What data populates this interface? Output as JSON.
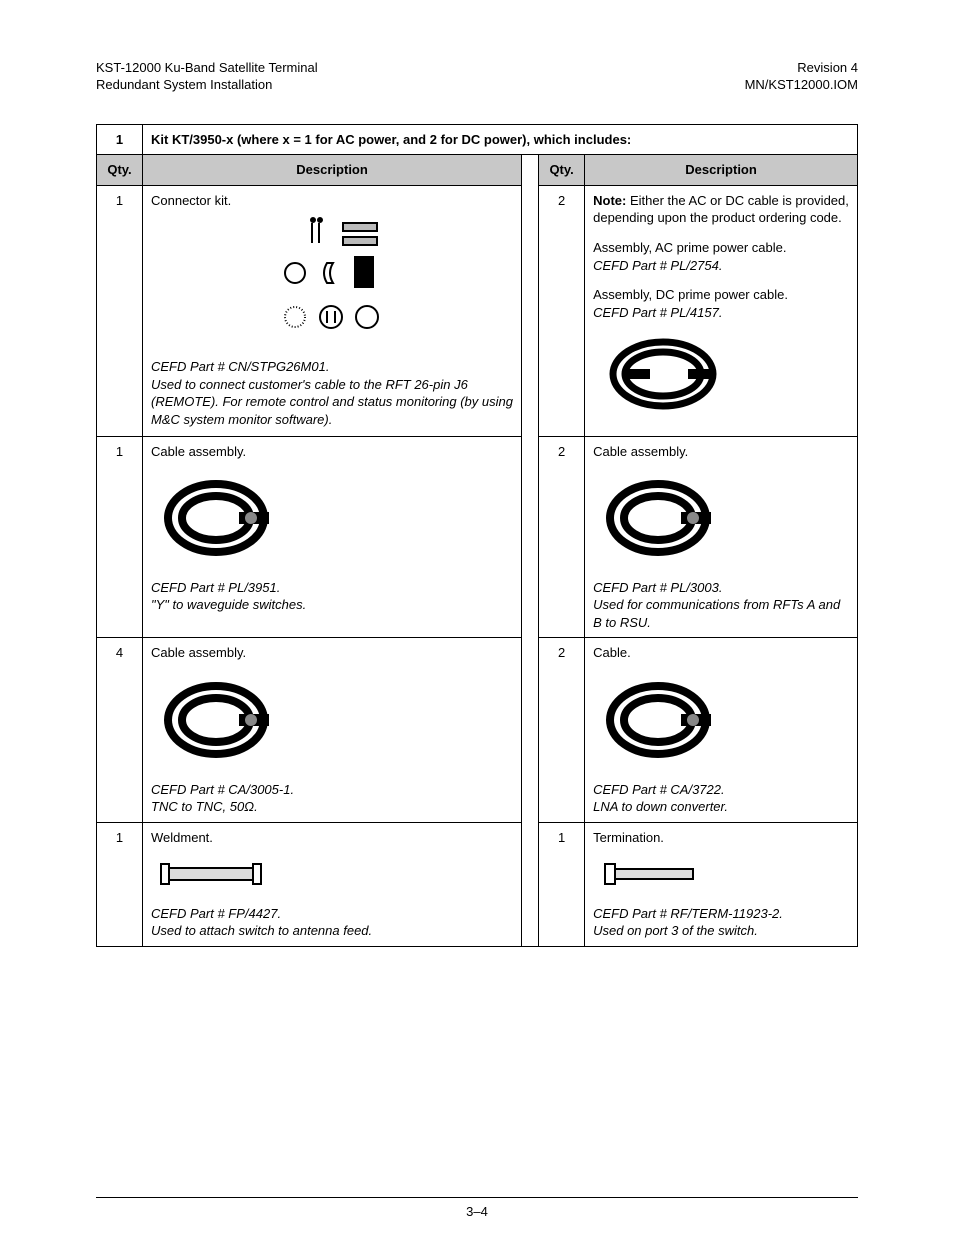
{
  "header": {
    "product_line1": "KST-12000 Ku-Band Satellite Terminal",
    "product_line2": "Redundant System Installation",
    "revision": "Revision 4",
    "docnum": "MN/KST12000.IOM"
  },
  "kit": {
    "number": "1",
    "title": "Kit KT/3950-x (where x = 1 for AC power, and 2 for DC power), which includes:"
  },
  "col_headers": {
    "qty": "Qty.",
    "desc": "Description"
  },
  "rows": {
    "r1a": {
      "qty": "1",
      "title": "Connector kit.",
      "part": "CEFD Part # CN/STPG26M01.",
      "note": "Used to connect customer's cable to the RFT 26-pin J6 (REMOTE). For remote control and status monitoring (by using M&C system monitor software)."
    },
    "r1b": {
      "qty": "2",
      "note_bold": "Note:",
      "note_rest": " Either the AC or DC cable is provided, depending upon the product ordering code.",
      "ac_line": "Assembly, AC prime power cable.",
      "ac_part": "CEFD Part # PL/2754.",
      "dc_line": "Assembly, DC prime power cable.",
      "dc_part": "CEFD Part # PL/4157."
    },
    "r2a": {
      "qty": "1",
      "title": "Cable assembly.",
      "part": "CEFD Part # PL/3951.",
      "note": "\"Y\" to waveguide switches."
    },
    "r2b": {
      "qty": "2",
      "title": "Cable assembly.",
      "part": "CEFD Part # PL/3003.",
      "note": "Used for communications from RFTs A and B to RSU."
    },
    "r3a": {
      "qty": "4",
      "title": "Cable assembly.",
      "part": "CEFD Part # CA/3005-1.",
      "note": "TNC to TNC, 50Ω."
    },
    "r3b": {
      "qty": "2",
      "title": "Cable.",
      "part": "CEFD Part # CA/3722.",
      "note": "LNA to down converter."
    },
    "r4a": {
      "qty": "1",
      "title": "Weldment.",
      "part": "CEFD Part # FP/4427.",
      "note": "Used to attach switch to antenna feed."
    },
    "r4b": {
      "qty": "1",
      "title": "Termination.",
      "part": "CEFD Part # RF/TERM-11923-2.",
      "note": "Used on port 3 of the switch."
    }
  },
  "page_number": "3–4"
}
